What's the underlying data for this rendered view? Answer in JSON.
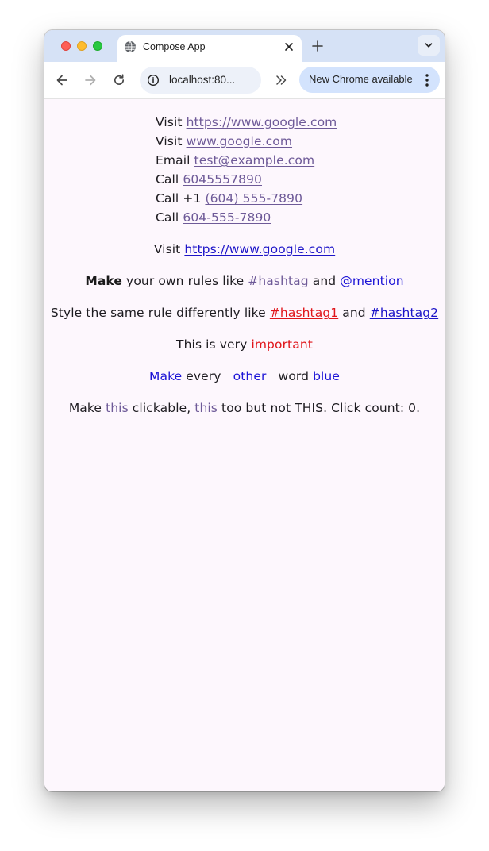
{
  "browser": {
    "tab_title": "Compose App",
    "url": "localhost:80...",
    "update_label": "New Chrome available",
    "icons": {
      "favicon": "globe-icon",
      "tab_close": "close-icon",
      "new_tab": "plus-icon",
      "tab_search": "chevron-down-icon",
      "back": "arrow-left-icon",
      "forward": "arrow-right-icon",
      "reload": "reload-icon",
      "site_info": "info-icon",
      "extensions": "double-chevron-right-icon",
      "menu": "more-vert-icon"
    }
  },
  "content": {
    "block": [
      {
        "prefix": "Visit ",
        "link": "https://www.google.com"
      },
      {
        "prefix": "Visit ",
        "link": "www.google.com"
      },
      {
        "prefix": "Email ",
        "link": "test@example.com"
      },
      {
        "prefix": "Call ",
        "link": "6045557890"
      },
      {
        "prefix": "Call +1 ",
        "link": "(604) 555-7890"
      },
      {
        "prefix": "Call ",
        "link": "604-555-7890"
      }
    ],
    "visit_line": {
      "prefix": "Visit ",
      "link": "https://www.google.com"
    },
    "hashtag_line": {
      "bold": "Make",
      "text1": " your own rules like ",
      "hashtag": "#hashtag",
      "text2": " and ",
      "mention": "@mention"
    },
    "style_line": {
      "text1": "Style the same rule differently like ",
      "hashtag1": "#hashtag1",
      "text2": " and ",
      "hashtag2": "#hashtag2"
    },
    "important_line": {
      "text": "This is very ",
      "highlight": "important"
    },
    "blue_line": {
      "w1": "Make",
      "w2": " every ",
      "w3": " other ",
      "w4": " word ",
      "w5": "blue"
    },
    "clickable_line": {
      "text1": "Make ",
      "link1": "this",
      "text2": " clickable, ",
      "link2": "this",
      "text3": " too but not THIS. Click count: 0."
    }
  },
  "colors": {
    "page_bg": "#fdf7fd",
    "link_purple": "#6e5a98",
    "link_blue": "#1c14c8",
    "highlight_red": "#e0151a",
    "tab_strip": "#d6e2f6",
    "update_pill": "#d3e3fd"
  }
}
